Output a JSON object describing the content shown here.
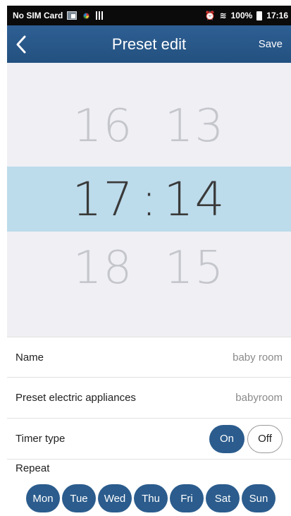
{
  "status_bar": {
    "carrier": "No SIM Card",
    "battery": "100%",
    "time": "17:16",
    "icons": [
      "notification-icon",
      "app-icon",
      "signal-bars-icon",
      "alarm-icon",
      "wifi-icon",
      "battery-icon"
    ]
  },
  "header": {
    "title": "Preset edit",
    "save_label": "Save",
    "back_icon": "chevron-left-icon",
    "color": "#2b5c8d"
  },
  "time_picker": {
    "separator": ":",
    "above": {
      "hour": "16",
      "minute": "13"
    },
    "selected": {
      "hour": "17",
      "minute": "14"
    },
    "below": {
      "hour": "18",
      "minute": "15"
    },
    "highlight_color": "#bcdbeb"
  },
  "settings": {
    "name": {
      "label": "Name",
      "value": "baby room"
    },
    "appliances": {
      "label": "Preset electric appliances",
      "value": "babyroom"
    },
    "timer_type": {
      "label": "Timer type",
      "on_label": "On",
      "off_label": "Off",
      "selected": "On"
    }
  },
  "repeat": {
    "label": "Repeat",
    "days": [
      "Mon",
      "Tue",
      "Wed",
      "Thu",
      "Fri",
      "Sat",
      "Sun"
    ]
  }
}
